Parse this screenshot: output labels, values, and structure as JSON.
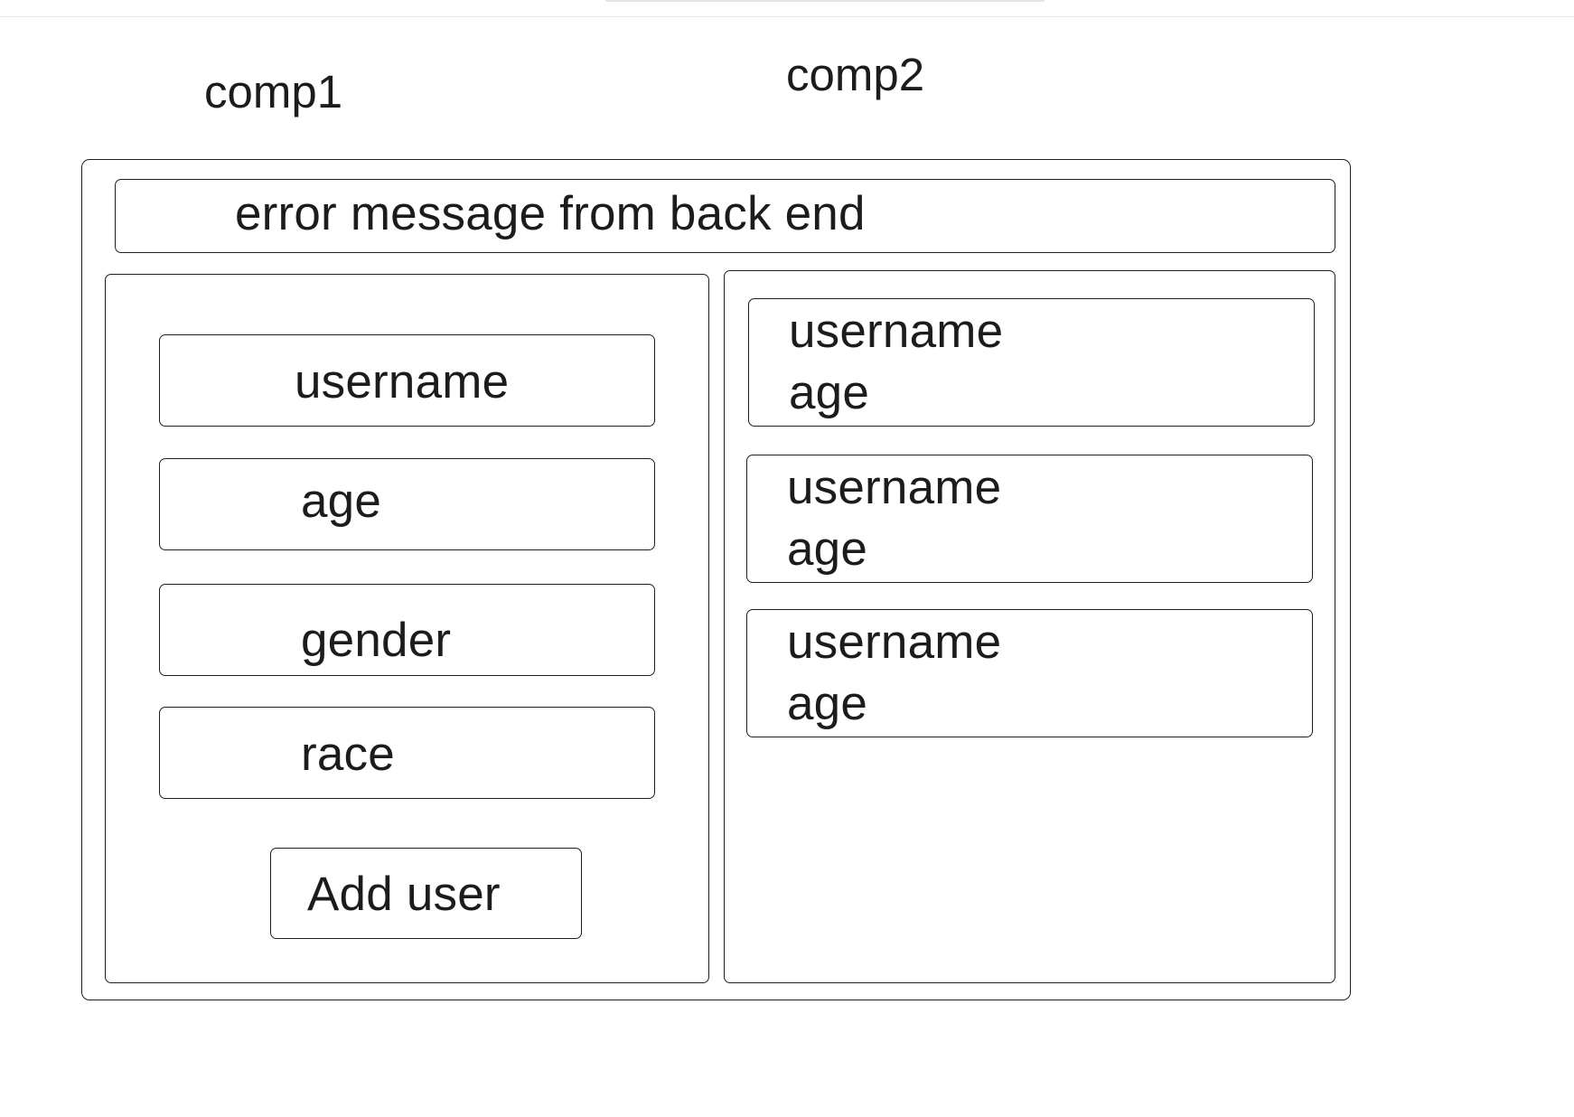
{
  "labels": {
    "comp1": "comp1",
    "comp2": "comp2"
  },
  "error_banner": {
    "text": "error message from back end"
  },
  "form": {
    "fields": [
      {
        "label": "username"
      },
      {
        "label": "age"
      },
      {
        "label": "gender"
      },
      {
        "label": "race"
      }
    ],
    "submit_label": "Add user"
  },
  "user_list": {
    "cards": [
      {
        "username": "username",
        "age": "age"
      },
      {
        "username": "username",
        "age": "age"
      },
      {
        "username": "username",
        "age": "age"
      }
    ]
  }
}
